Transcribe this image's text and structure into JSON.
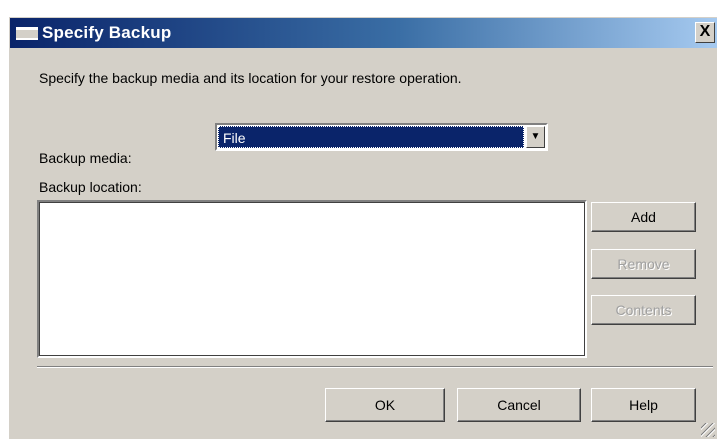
{
  "window": {
    "title": "Specify Backup",
    "close_glyph": "X"
  },
  "instruction": "Specify the backup media and its location for your restore operation.",
  "media": {
    "label": "Backup media:",
    "selected": "File",
    "dropdown_glyph": "▼"
  },
  "location": {
    "label": "Backup location:",
    "entries": []
  },
  "side_buttons": {
    "add": "Add",
    "remove": "Remove",
    "contents": "Contents"
  },
  "footer_buttons": {
    "ok": "OK",
    "cancel": "Cancel",
    "help": "Help"
  },
  "colors": {
    "titlebar_start": "#0a246a",
    "titlebar_end": "#a6caf0",
    "dialog_bg": "#d4d0c8",
    "selection_bg": "#0a246a",
    "disabled_text": "#a0a0a0"
  }
}
